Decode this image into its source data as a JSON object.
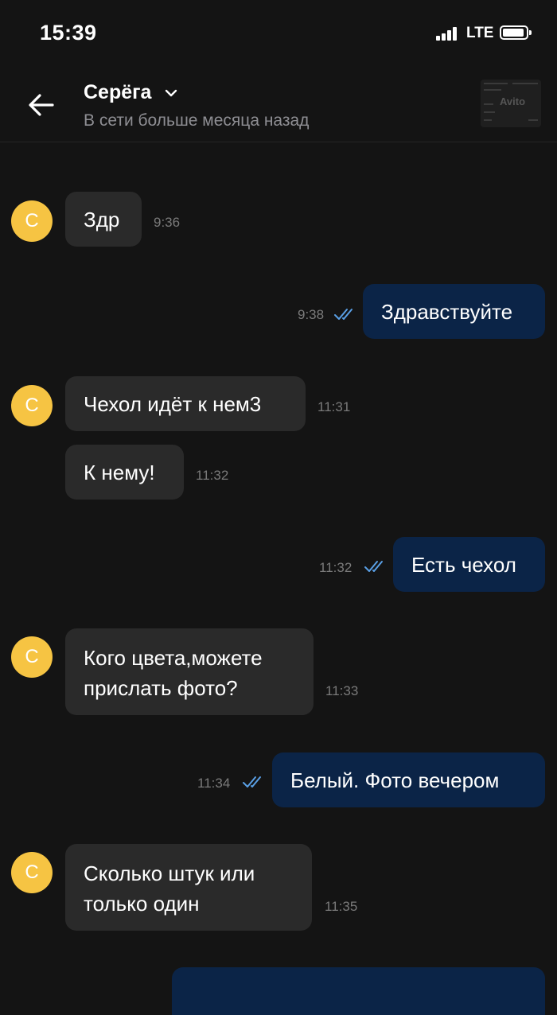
{
  "status_bar": {
    "time": "15:39",
    "network": "LTE"
  },
  "header": {
    "name": "Серёга",
    "status": "В сети больше месяца назад",
    "ad_thumb_logo": "Avito"
  },
  "contact_avatar_letter": "С",
  "colors": {
    "background": "#141414",
    "incoming_bubble": "#2a2a2a",
    "outgoing_bubble": "#0b2447",
    "avatar": "#f6c443",
    "read_check": "#5aa0e6"
  },
  "messages": [
    {
      "direction": "in",
      "text": "Здр",
      "time": "9:36"
    },
    {
      "direction": "out",
      "text": "Здравствуйте",
      "time": "9:38",
      "read": true
    },
    {
      "direction": "in",
      "text": "Чехол идёт к нем3",
      "time": "11:31"
    },
    {
      "direction": "in",
      "text": "К нему!",
      "time": "11:32"
    },
    {
      "direction": "out",
      "text": "Есть чехол",
      "time": "11:32",
      "read": true
    },
    {
      "direction": "in",
      "text": "Кого цвета,можете прислать фото?",
      "time": "11:33"
    },
    {
      "direction": "out",
      "text": "Белый. Фото вечером",
      "time": "11:34",
      "read": true
    },
    {
      "direction": "in",
      "text": "Сколько штук или только один",
      "time": "11:35"
    }
  ]
}
